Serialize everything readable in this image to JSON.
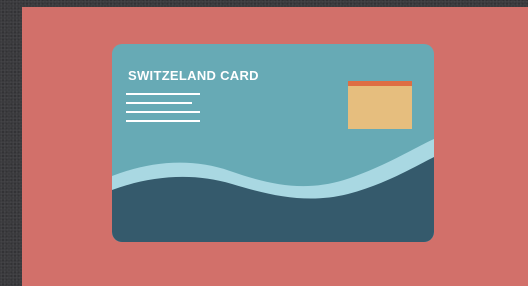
{
  "card": {
    "title": "SWITZELAND CARD"
  },
  "colors": {
    "background": "#3a3a3d",
    "panel": "#d2706a",
    "card_top": "#67aab5",
    "card_wave_stripe": "#a9d8e2",
    "card_bottom": "#355a6c",
    "chip": "#e6be7e",
    "chip_band": "#de6e44",
    "text": "#ffffff"
  },
  "icons": {
    "chip": "card-chip-icon",
    "text_lines": "text-lines-icon",
    "wave": "wave-decoration"
  }
}
